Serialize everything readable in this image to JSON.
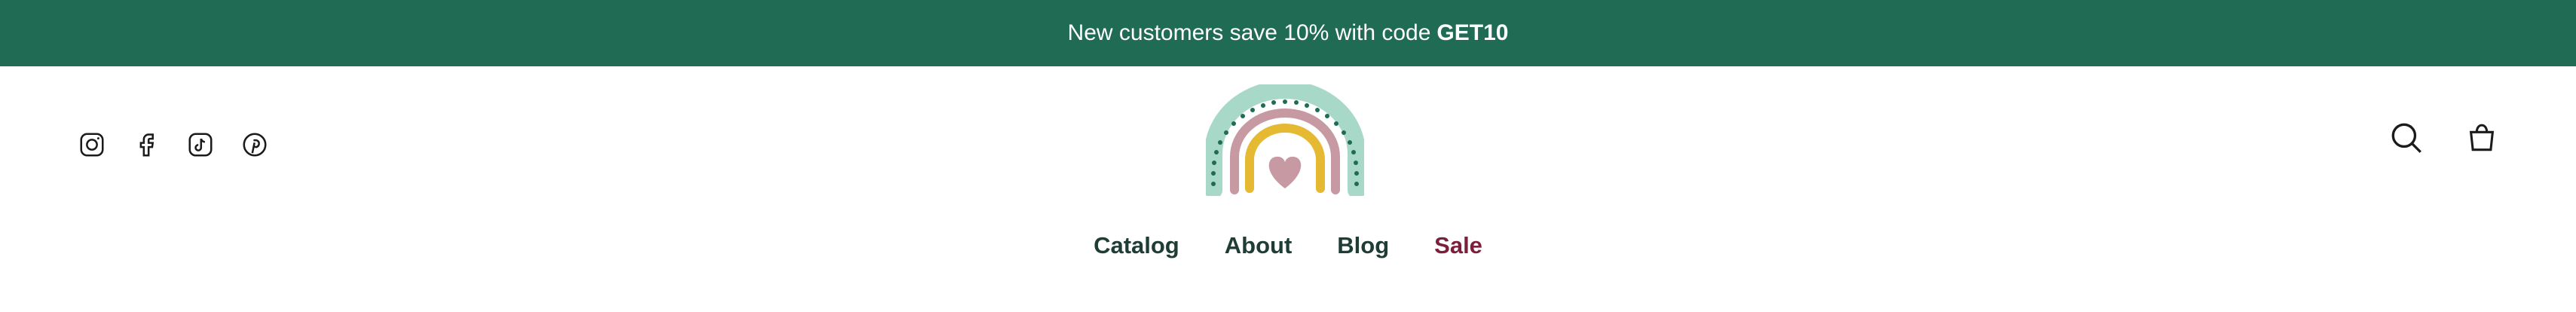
{
  "announcement": {
    "prefix": "New customers save 10% with code",
    "code": "GET10"
  },
  "social_icons": [
    "instagram-icon",
    "facebook-icon",
    "tiktok-icon",
    "pinterest-icon"
  ],
  "actions": [
    "search-icon",
    "cart-icon"
  ],
  "nav": {
    "items": [
      "Catalog",
      "About",
      "Blog",
      "Sale"
    ]
  },
  "colors": {
    "announcement_bg": "#1f6b53",
    "nav_text": "#1f3d35",
    "sale_text": "#7b1f3c",
    "rainbow_outer": "#a8d8c8",
    "rainbow_middle": "#c79aa3",
    "rainbow_inner": "#e6b933",
    "heart": "#c79aa3"
  }
}
